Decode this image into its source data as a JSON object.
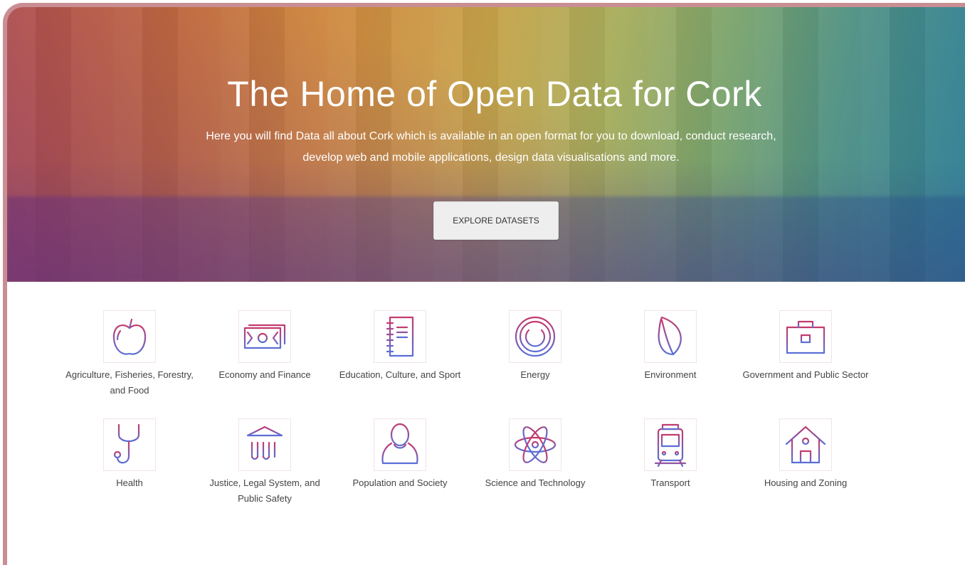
{
  "hero": {
    "title": "The Home of Open Data for Cork",
    "subtitle": "Here you will find Data all about Cork which is available in an open format for you to download, conduct research, develop web and mobile applications, design data visualisations and more.",
    "cta_label": "EXPLORE DATASETS"
  },
  "colors": {
    "icon_gradient_start": "#c43a6e",
    "icon_gradient_end": "#5a6fd6",
    "frame_border": "#c98e93",
    "button_bg": "#eeeeee"
  },
  "themes": [
    {
      "label": "Agriculture, Fisheries, Forestry, and Food",
      "icon": "apple-icon"
    },
    {
      "label": "Economy and Finance",
      "icon": "banknote-icon"
    },
    {
      "label": "Education, Culture, and Sport",
      "icon": "notebook-icon"
    },
    {
      "label": "Energy",
      "icon": "power-icon"
    },
    {
      "label": "Environment",
      "icon": "leaf-icon"
    },
    {
      "label": "Government and Public Sector",
      "icon": "briefcase-icon"
    },
    {
      "label": "Health",
      "icon": "stethoscope-icon"
    },
    {
      "label": "Justice, Legal System, and Public Safety",
      "icon": "courthouse-icon"
    },
    {
      "label": "Population and Society",
      "icon": "person-icon"
    },
    {
      "label": "Science and Technology",
      "icon": "atom-icon"
    },
    {
      "label": "Transport",
      "icon": "train-icon"
    },
    {
      "label": "Housing and Zoning",
      "icon": "house-icon"
    }
  ]
}
